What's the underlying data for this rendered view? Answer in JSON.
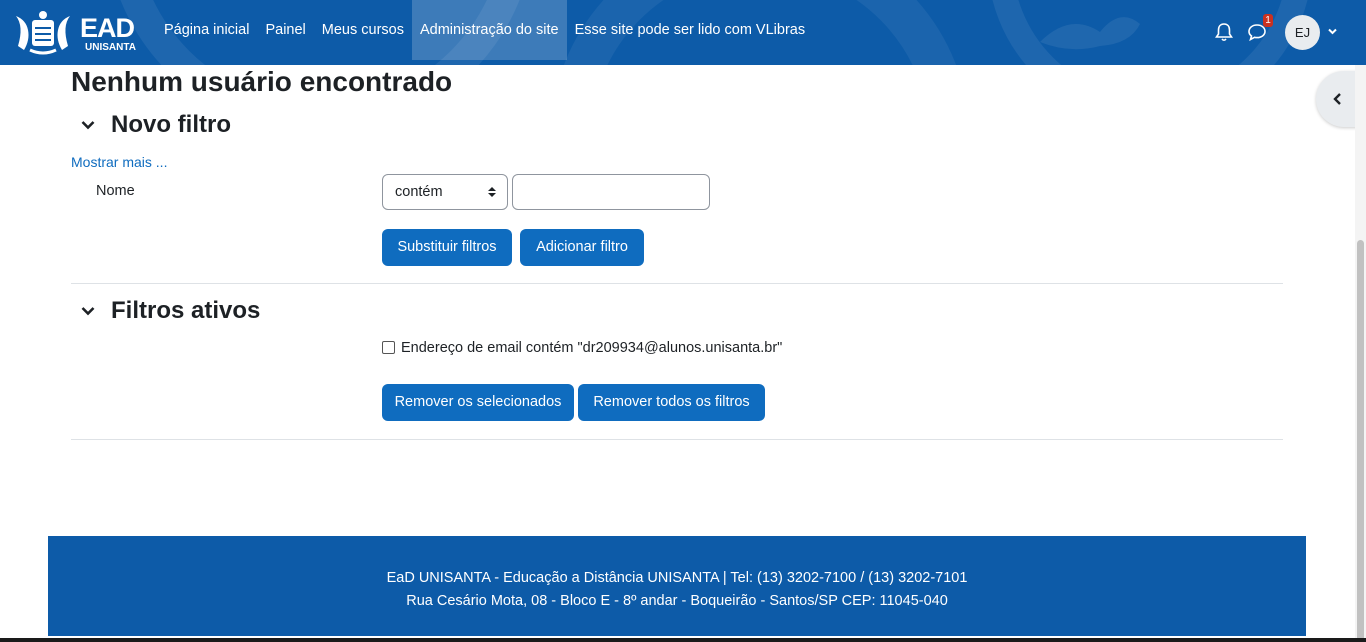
{
  "brand": {
    "logo_text": "EAD",
    "logo_sub": "UNISANTA"
  },
  "nav": {
    "links": [
      {
        "label": "Página inicial"
      },
      {
        "label": "Painel"
      },
      {
        "label": "Meus cursos"
      },
      {
        "label": "Administração do site"
      },
      {
        "label": "Esse site pode ser lido com VLibras"
      }
    ],
    "messages_badge": "1",
    "avatar_initials": "EJ",
    "brand_color": "#0d5ba8"
  },
  "main": {
    "heading": "Nenhum usuário encontrado",
    "new_filter": {
      "title": "Novo filtro",
      "show_more": "Mostrar mais ...",
      "field_label": "Nome",
      "operator_selected": "contém",
      "value": "",
      "replace_button": "Substituir filtros",
      "add_button": "Adicionar filtro"
    },
    "active_filters": {
      "title": "Filtros ativos",
      "items": [
        {
          "label": "Endereço de email contém \"dr209934@alunos.unisanta.br\"",
          "checked": false
        }
      ],
      "remove_selected_button": "Remover os selecionados",
      "remove_all_button": "Remover todos os filtros"
    },
    "button_color": "#0f6cbf"
  },
  "footer": {
    "line1_strong": "EaD UNISANTA - Educação a Distância UNISANTA",
    "line1_rest": " | Tel: (13) 3202-7100 / (13) 3202-7101",
    "line2": "Rua Cesário Mota, 08 - Bloco E - 8º andar - Boqueirão - Santos/SP CEP: 11045-040"
  }
}
